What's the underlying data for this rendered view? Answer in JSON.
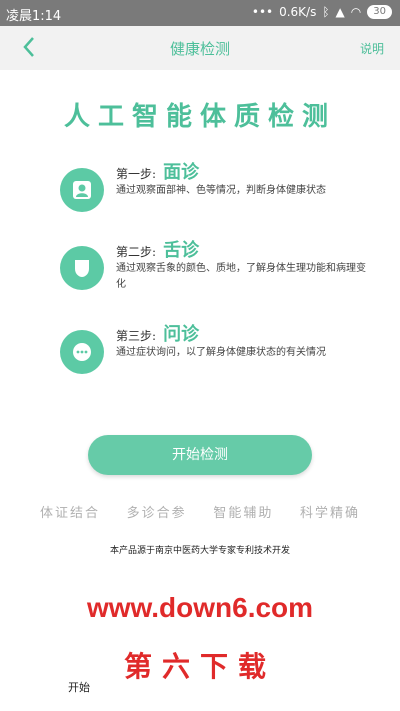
{
  "status": {
    "time": "凌晨1:14",
    "speed": "0.6K/s",
    "battery": "30"
  },
  "header": {
    "title": "健康检测",
    "help_label": "说明"
  },
  "headline": "人工智能体质检测",
  "steps": [
    {
      "label": "第一步:",
      "name": "面诊",
      "desc": "通过观察面部神、色等情况，判断身体健康状态",
      "icon": "person-icon"
    },
    {
      "label": "第二步:",
      "name": "舌诊",
      "desc": "通过观察舌象的颜色、质地，了解身体生理功能和病理变化",
      "icon": "tongue-icon"
    },
    {
      "label": "第三步:",
      "name": "问诊",
      "desc": "通过症状询问，以了解身体健康状态的有关情况",
      "icon": "chat-icon"
    }
  ],
  "start_button": "开始检测",
  "features": [
    "体证结合",
    "多诊合参",
    "智能辅助",
    "科学精确"
  ],
  "source_note": "本产品源于南京中医药大学专家专利技术开发",
  "watermark": {
    "url": "www.down6.com",
    "name": "第六下载"
  },
  "cut_text": "开始"
}
